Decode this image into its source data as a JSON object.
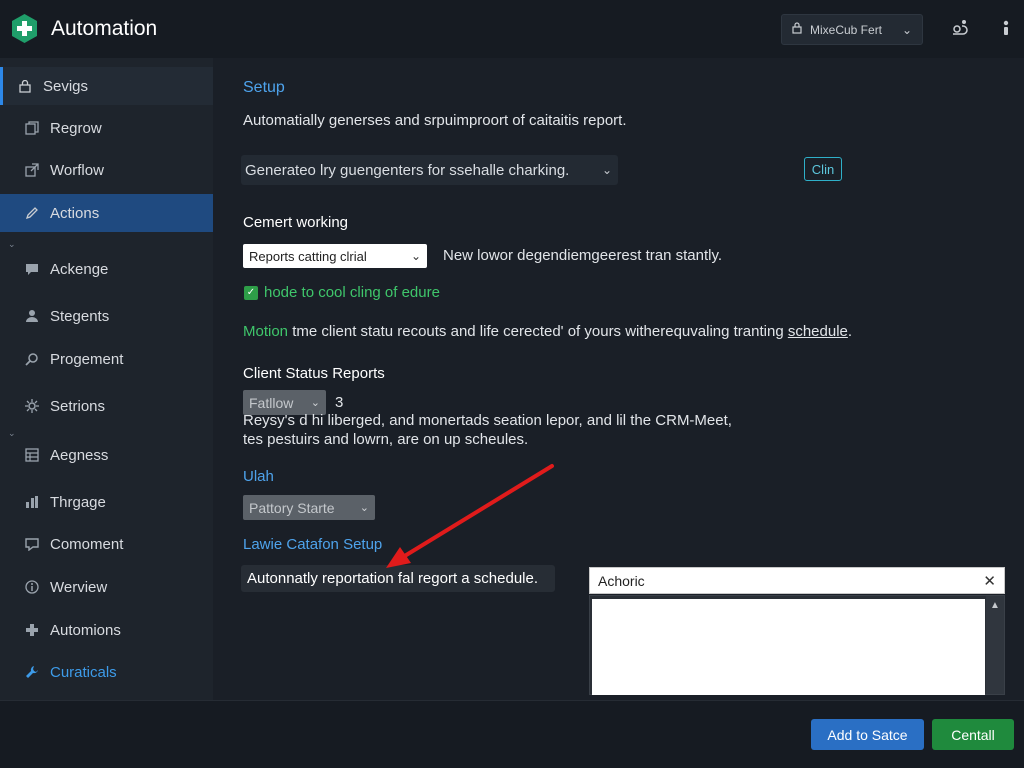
{
  "app": {
    "title": "Automation"
  },
  "header": {
    "user_menu_label": "MixeCub Fert"
  },
  "sidebar": {
    "items": [
      {
        "label": "Sevigs",
        "icon": "lock-icon"
      },
      {
        "label": "Regrow",
        "icon": "copy-icon"
      },
      {
        "label": "Worflow",
        "icon": "external-link-icon"
      },
      {
        "label": "Actions",
        "icon": "pencil-icon"
      },
      {
        "label": "Ackenge",
        "icon": "chat-bubble-icon"
      },
      {
        "label": "Stegents",
        "icon": "person-icon"
      },
      {
        "label": "Progement",
        "icon": "search-icon"
      },
      {
        "label": "Setrions",
        "icon": "settings-icon"
      },
      {
        "label": "Aegness",
        "icon": "grid-icon"
      },
      {
        "label": "Thrgage",
        "icon": "bar-chart-icon"
      },
      {
        "label": "Comoment",
        "icon": "comment-icon"
      },
      {
        "label": "Werview",
        "icon": "info-icon"
      },
      {
        "label": "Automions",
        "icon": "puzzle-icon"
      },
      {
        "label": "Curaticals",
        "icon": "wrench-icon"
      }
    ]
  },
  "main": {
    "setup_title": "Setup",
    "setup_desc": "Automatially generses and srpuimproort of caitaitis report.",
    "generator_select": "Generateo lry guengenters for ssehalle charking.",
    "outline_button": "Clin",
    "current_heading": "Cemert working",
    "reports_select": "Reports catting clrial",
    "reports_note": "New lowor degendiemgeerest tran stantly.",
    "checkbox_label": "hode to cool cling of edure",
    "motion_label": "Motion",
    "motion_text": "tme client statu recouts and life cerected' of  yours witherequvaling tranting ",
    "motion_link": "schedule",
    "motion_end": ".",
    "client_heading": "Client Status Reports",
    "fallow_select": "Fatllow",
    "fallow_number": "3",
    "client_desc_line1": "Reysy's d hi liberged, and monertads seation lepor, and lil the CRM-Meet,",
    "client_desc_line2": "tes pestuirs and lowrn, are on up scheules.",
    "utah_label": "Ulah",
    "pattory_select": "Pattory Starte",
    "lawie_heading": "Lawie Catafon Setup",
    "callout_text": "Autonnatly reportation fal regort a schedule."
  },
  "panel": {
    "title": "Achoric"
  },
  "footer": {
    "primary_label": "Add to Satce",
    "secondary_label": "Centall"
  },
  "colors": {
    "accent": "#2d88e8",
    "active_nav": "#1f4a80",
    "green": "#1f8a3d",
    "arrow": "#e01b1b"
  }
}
